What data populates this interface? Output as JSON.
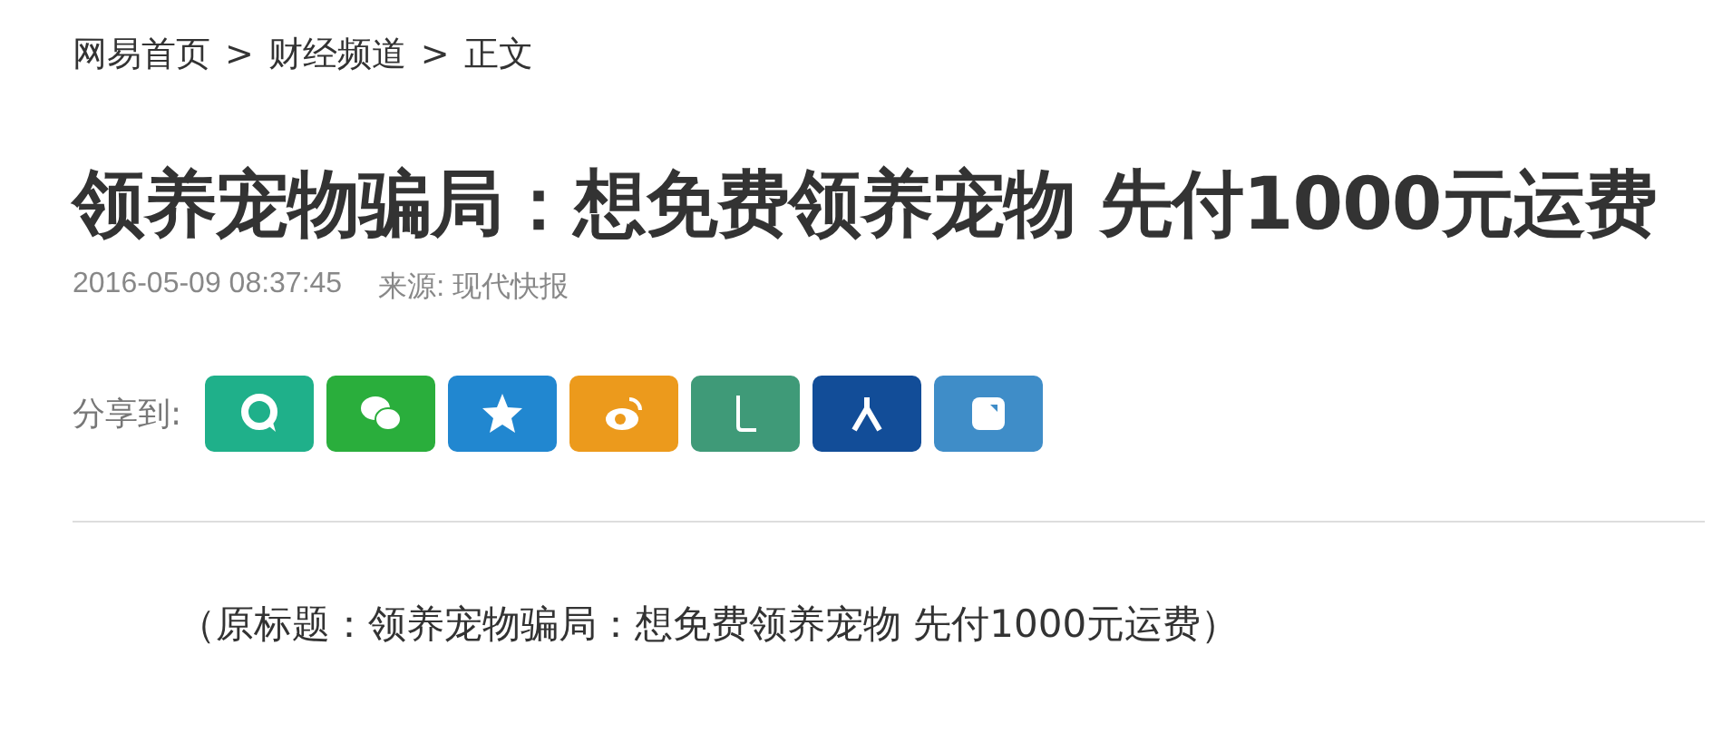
{
  "breadcrumb": [
    "网易首页",
    ">",
    "财经频道",
    ">",
    "正文"
  ],
  "title": "领养宠物骗局：想免费领养宠物 先付1000元运费",
  "meta": {
    "time": "2016-05-09 08:37:45",
    "source": "来源: 现代快报"
  },
  "share": {
    "label": "分享到:",
    "buttons": [
      {
        "kind": "bubble",
        "color": "#1fb08a"
      },
      {
        "kind": "chat",
        "color": "#2aae3c"
      },
      {
        "kind": "star",
        "color": "#2187d0"
      },
      {
        "kind": "swirl",
        "color": "#ec9a1c"
      },
      {
        "kind": "hook",
        "color": "#3f9a78"
      },
      {
        "kind": "figure",
        "color": "#124d98"
      },
      {
        "kind": "square",
        "color": "#3f8dc8"
      }
    ]
  },
  "subtitle": "（原标题：领养宠物骗局：想免费领养宠物 先付1000元运费）"
}
